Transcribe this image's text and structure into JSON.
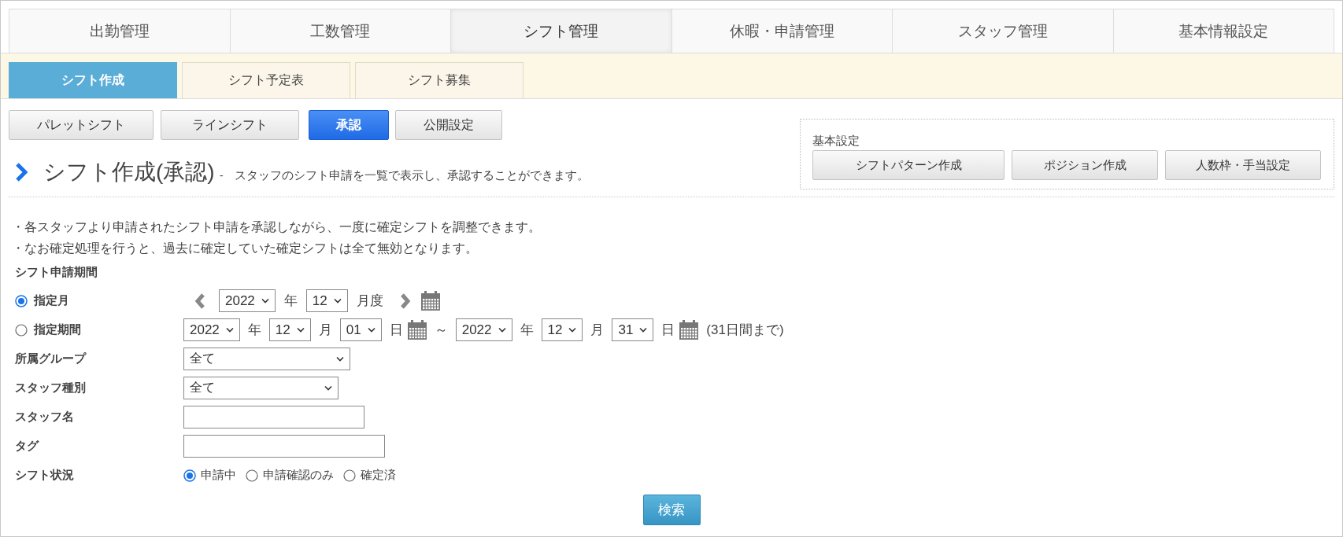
{
  "top_nav": [
    {
      "label": "出勤管理",
      "selected": false
    },
    {
      "label": "工数管理",
      "selected": false
    },
    {
      "label": "シフト管理",
      "selected": true
    },
    {
      "label": "休暇・申請管理",
      "selected": false
    },
    {
      "label": "スタッフ管理",
      "selected": false
    },
    {
      "label": "基本情報設定",
      "selected": false
    }
  ],
  "sub_tabs": [
    {
      "label": "シフト作成",
      "selected": true
    },
    {
      "label": "シフト予定表",
      "selected": false
    },
    {
      "label": "シフト募集",
      "selected": false
    }
  ],
  "mode_buttons": [
    {
      "label": "パレットシフト",
      "selected": false
    },
    {
      "label": "ラインシフト",
      "selected": false
    },
    {
      "label": "承認",
      "selected": true
    },
    {
      "label": "公開設定",
      "selected": false
    }
  ],
  "basic_settings": {
    "title": "基本設定",
    "buttons": [
      "シフトパターン作成",
      "ポジション作成",
      "人数枠・手当設定"
    ]
  },
  "heading": {
    "title": "シフト作成(承認)",
    "separator": "-",
    "description": "スタッフのシフト申請を一覧で表示し、承認することができます。"
  },
  "notes": [
    "・各スタッフより申請されたシフト申請を承認しながら、一度に確定シフトを調整できます。",
    "・なお確定処理を行うと、過去に確定していた確定シフトは全て無効となります。"
  ],
  "form": [
    {
      "kind": "heading",
      "label": "シフト申請期間"
    },
    {
      "kind": "period",
      "label": "指定月",
      "selected": true,
      "controls": [
        {
          "kind": "prev"
        },
        {
          "kind": "select",
          "value": "2022"
        },
        {
          "kind": "text",
          "value": "年"
        },
        {
          "kind": "select",
          "value": "12"
        },
        {
          "kind": "text",
          "value": "月度"
        },
        {
          "kind": "next"
        },
        {
          "kind": "calendar"
        }
      ]
    },
    {
      "kind": "period",
      "label": "指定期間",
      "selected": false,
      "controls": [
        {
          "kind": "select",
          "value": "2022"
        },
        {
          "kind": "text",
          "value": "年"
        },
        {
          "kind": "select",
          "value": "12"
        },
        {
          "kind": "text",
          "value": "月"
        },
        {
          "kind": "select",
          "value": "01"
        },
        {
          "kind": "text",
          "value": "日"
        },
        {
          "kind": "calendar"
        },
        {
          "kind": "text",
          "value": "～"
        },
        {
          "kind": "select",
          "value": "2022"
        },
        {
          "kind": "text",
          "value": "年"
        },
        {
          "kind": "select",
          "value": "12"
        },
        {
          "kind": "text",
          "value": "月"
        },
        {
          "kind": "select",
          "value": "31"
        },
        {
          "kind": "text",
          "value": "日"
        },
        {
          "kind": "calendar"
        },
        {
          "kind": "text",
          "value": "(31日間まで)"
        }
      ]
    },
    {
      "kind": "select",
      "label": "所属グループ",
      "value": "全て"
    },
    {
      "kind": "select",
      "label": "スタッフ種別",
      "value": "全て"
    },
    {
      "kind": "input",
      "label": "スタッフ名"
    },
    {
      "kind": "input",
      "label": "タグ"
    },
    {
      "kind": "radios",
      "label": "シフト状況",
      "options": [
        {
          "label": "申請中",
          "selected": true
        },
        {
          "label": "申請確認のみ",
          "selected": false
        },
        {
          "label": "確定済",
          "selected": false
        }
      ]
    }
  ],
  "search_button": "検索"
}
